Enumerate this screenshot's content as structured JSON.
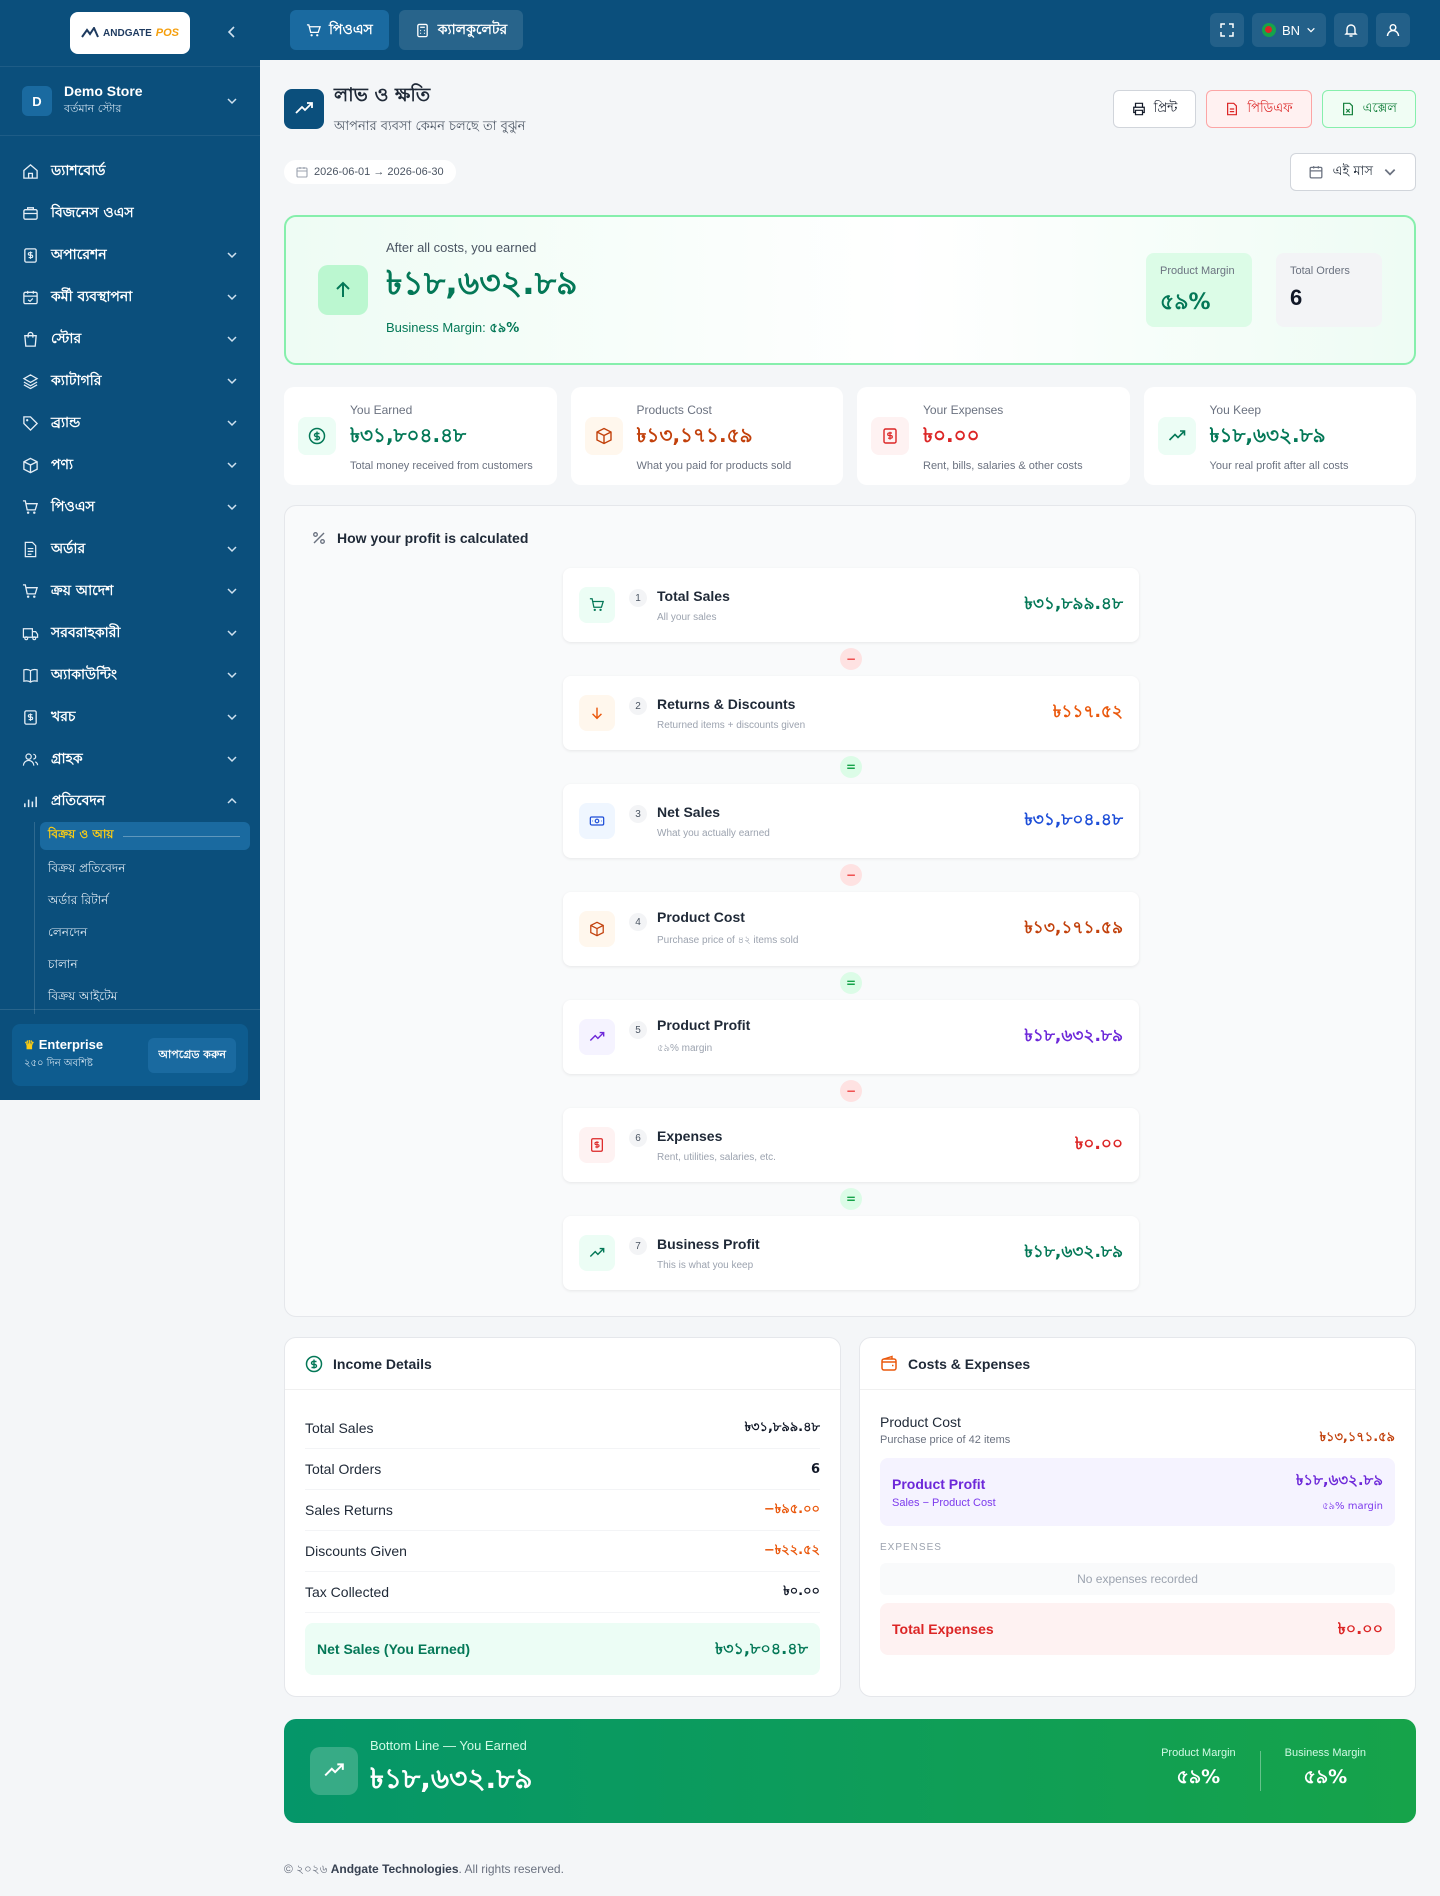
{
  "sidebar": {
    "logo_text": "ANDGATE",
    "logo_accent": "POS",
    "store_initial": "D",
    "store_name": "Demo Store",
    "store_sub": "বর্তমান স্টোর",
    "items": [
      {
        "label": "ড্যাশবোর্ড",
        "icon": "home-icon",
        "has_chevron": false
      },
      {
        "label": "বিজনেস ওএস",
        "icon": "briefcase-icon",
        "has_chevron": false
      },
      {
        "label": "অপারেশন",
        "icon": "receipt-icon",
        "has_chevron": true
      },
      {
        "label": "কর্মী ব্যবস্থাপনা",
        "icon": "calendar-icon",
        "has_chevron": true
      },
      {
        "label": "স্টোর",
        "icon": "shopping-bag-icon",
        "has_chevron": true
      },
      {
        "label": "ক্যাটাগরি",
        "icon": "layers-icon",
        "has_chevron": true
      },
      {
        "label": "ব্র্যান্ড",
        "icon": "tag-icon",
        "has_chevron": true
      },
      {
        "label": "পণ্য",
        "icon": "box-icon",
        "has_chevron": true
      },
      {
        "label": "পিওএস",
        "icon": "cart-icon",
        "has_chevron": true
      },
      {
        "label": "অর্ডার",
        "icon": "file-icon",
        "has_chevron": true
      },
      {
        "label": "ক্রয় আদেশ",
        "icon": "cart-icon",
        "has_chevron": true
      },
      {
        "label": "সরবরাহকারী",
        "icon": "truck-icon",
        "has_chevron": true
      },
      {
        "label": "অ্যাকাউন্টিং",
        "icon": "book-icon",
        "has_chevron": true
      },
      {
        "label": "খরচ",
        "icon": "receipt-icon",
        "has_chevron": true
      },
      {
        "label": "গ্রাহক",
        "icon": "users-icon",
        "has_chevron": true
      },
      {
        "label": "প্রতিবেদন",
        "icon": "bar-chart-icon",
        "has_chevron": true
      }
    ],
    "sub_items": [
      {
        "label": "বিক্রয় ও আয়",
        "active": true
      },
      {
        "label": "বিক্রয় প্রতিবেদন",
        "active": false
      },
      {
        "label": "অর্ডার রিটার্ন",
        "active": false
      },
      {
        "label": "লেনদেন",
        "active": false
      },
      {
        "label": "চালান",
        "active": false
      },
      {
        "label": "বিক্রয় আইটেম",
        "active": false
      }
    ],
    "plan_name": "Enterprise",
    "plan_sub": "২৫০ দিন অবশিষ্ট",
    "upgrade_label": "আপগ্রেড করুন"
  },
  "topbar": {
    "pos_label": "পিওএস",
    "calc_label": "ক্যালকুলেটর",
    "lang": "BN"
  },
  "page": {
    "title": "লাভ ও ক্ষতি",
    "subtitle": "আপনার ব্যবসা কেমন চলছে তা বুঝুন",
    "print_label": "প্রিন্ট",
    "pdf_label": "পিডিএফ",
    "excel_label": "এক্সেল",
    "date_range": "2026-06-01 → 2026-06-30",
    "period_label": "এই মাস"
  },
  "hero": {
    "label": "After all costs, you earned",
    "value": "৳১৮,৬৩২.৮৯",
    "margin_prefix": "Business Margin:",
    "margin_value": "৫৯%",
    "product_margin_label": "Product Margin",
    "product_margin_value": "৫৯%",
    "total_orders_label": "Total Orders",
    "total_orders_value": "6"
  },
  "kpis": [
    {
      "label": "You Earned",
      "value": "৳৩১,৮০৪.৪৮",
      "desc": "Total money received from customers",
      "icon": "dollar-icon",
      "color": "#047857",
      "bg": "#ecfdf5"
    },
    {
      "label": "Products Cost",
      "value": "৳১৩,১৭১.৫৯",
      "desc": "What you paid for products sold",
      "icon": "box-icon",
      "color": "#c2410c",
      "bg": "#fff7ed"
    },
    {
      "label": "Your Expenses",
      "value": "৳০.০০",
      "desc": "Rent, bills, salaries & other costs",
      "icon": "receipt-icon",
      "color": "#dc2626",
      "bg": "#fef2f2"
    },
    {
      "label": "You Keep",
      "value": "৳১৮,৬৩২.৮৯",
      "desc": "Your real profit after all costs",
      "icon": "trend-up-icon",
      "color": "#047857",
      "bg": "#ecfdf5"
    }
  ],
  "calc": {
    "title": "How your profit is calculated",
    "steps": [
      {
        "num": "1",
        "title": "Total Sales",
        "desc": "All your sales",
        "value": "৳৩১,৮৯৯.৪৮",
        "icon": "cart-icon",
        "color": "#047857",
        "bg": "#ecfdf5"
      },
      {
        "num": "2",
        "title": "Returns & Discounts",
        "desc": "Returned items + discounts given",
        "value": "৳১১৭.৫২",
        "icon": "arrow-down-icon",
        "color": "#ea580c",
        "bg": "#fff7ed"
      },
      {
        "num": "3",
        "title": "Net Sales",
        "desc": "What you actually earned",
        "value": "৳৩১,৮০৪.৪৮",
        "icon": "cash-icon",
        "color": "#1d4ed8",
        "bg": "#eff6ff"
      },
      {
        "num": "4",
        "title": "Product Cost",
        "desc": "Purchase price of ৪২ items sold",
        "value": "৳১৩,১৭১.৫৯",
        "icon": "box-icon",
        "color": "#c2410c",
        "bg": "#fff7ed"
      },
      {
        "num": "5",
        "title": "Product Profit",
        "desc": "৫৯% margin",
        "value": "৳১৮,৬৩২.৮৯",
        "icon": "trend-up-icon",
        "color": "#6d28d9",
        "bg": "#f5f3ff"
      },
      {
        "num": "6",
        "title": "Expenses",
        "desc": "Rent, utilities, salaries, etc.",
        "value": "৳০.০০",
        "icon": "receipt-icon",
        "color": "#dc2626",
        "bg": "#fef2f2"
      },
      {
        "num": "7",
        "title": "Business Profit",
        "desc": "This is what you keep",
        "value": "৳১৮,৬৩২.৮৯",
        "icon": "trend-up-icon",
        "color": "#047857",
        "bg": "#ecfdf5"
      }
    ],
    "operators": [
      "−",
      "=",
      "−",
      "=",
      "−",
      "="
    ]
  },
  "income": {
    "title": "Income Details",
    "rows": [
      {
        "label": "Total Sales",
        "value": "৳৩১,৮৯৯.৪৮",
        "color": "#111827"
      },
      {
        "label": "Total Orders",
        "value": "6",
        "color": "#111827"
      },
      {
        "label": "Sales Returns",
        "value": "−৳৯৫.০০",
        "color": "#ea580c"
      },
      {
        "label": "Discounts Given",
        "value": "−৳২২.৫২",
        "color": "#ea580c"
      },
      {
        "label": "Tax Collected",
        "value": "৳০.০০",
        "color": "#111827"
      }
    ],
    "net_label": "Net Sales (You Earned)",
    "net_value": "৳৩১,৮০৪.৪৮"
  },
  "costs": {
    "title": "Costs & Expenses",
    "product_cost_label": "Product Cost",
    "product_cost_desc": "Purchase price of 42 items",
    "product_cost_value": "৳১৩,১৭১.৫৯",
    "profit_label": "Product Profit",
    "profit_desc": "Sales − Product Cost",
    "profit_value": "৳১৮,৬৩২.৮৯",
    "profit_margin": "৫৯% margin",
    "expenses_label": "EXPENSES",
    "no_expenses": "No expenses recorded",
    "total_label": "Total Expenses",
    "total_value": "৳০.০০"
  },
  "bottom": {
    "label": "Bottom Line — You Earned",
    "value": "৳১৮,৬৩২.৮৯",
    "pm_label": "Product Margin",
    "pm_value": "৫৯%",
    "bm_label": "Business Margin",
    "bm_value": "৫৯%"
  },
  "footer": {
    "prefix": "© ২০২৬",
    "company": "Andgate Technologies",
    "suffix": ". All rights reserved."
  }
}
